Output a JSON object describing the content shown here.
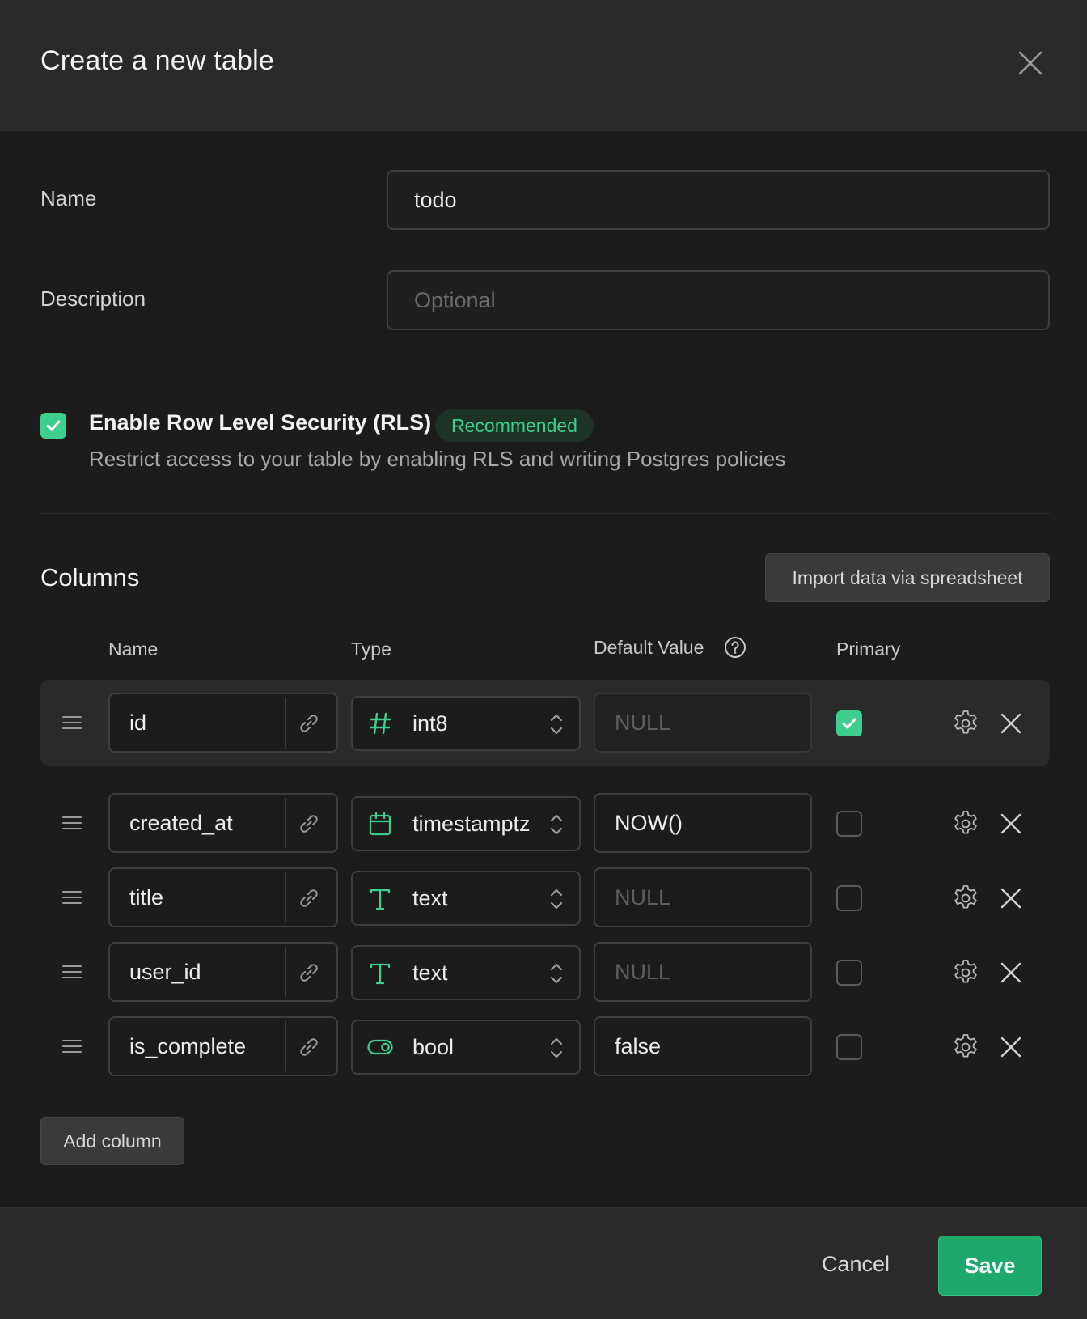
{
  "header": {
    "title": "Create a new table",
    "close_icon": "close-icon"
  },
  "form": {
    "name_label": "Name",
    "name_value": "todo",
    "description_label": "Description",
    "description_placeholder": "Optional"
  },
  "rls": {
    "checked": true,
    "title": "Enable Row Level Security (RLS)",
    "badge": "Recommended",
    "description": "Restrict access to your table by enabling RLS and writing Postgres policies"
  },
  "columns": {
    "section_title": "Columns",
    "import_button": "Import data via spreadsheet",
    "headers": {
      "name": "Name",
      "type": "Type",
      "default": "Default Value",
      "primary": "Primary"
    },
    "rows": [
      {
        "name": "id",
        "type": "int8",
        "type_icon": "hash-icon",
        "default": "NULL",
        "default_is_placeholder": true,
        "primary": true
      },
      {
        "name": "created_at",
        "type": "timestamptz",
        "type_icon": "calendar-icon",
        "default": "NOW()",
        "default_is_placeholder": false,
        "primary": false
      },
      {
        "name": "title",
        "type": "text",
        "type_icon": "text-type-icon",
        "default": "NULL",
        "default_is_placeholder": true,
        "primary": false
      },
      {
        "name": "user_id",
        "type": "text",
        "type_icon": "text-type-icon",
        "default": "NULL",
        "default_is_placeholder": true,
        "primary": false
      },
      {
        "name": "is_complete",
        "type": "bool",
        "type_icon": "toggle-icon",
        "default": "false",
        "default_is_placeholder": false,
        "primary": false
      }
    ],
    "add_button": "Add column"
  },
  "footer": {
    "cancel_label": "Cancel",
    "save_label": "Save"
  },
  "colors": {
    "accent": "#3ecf8e",
    "save": "#1fa86c",
    "background": "#1c1c1c",
    "header": "#2a2a2a"
  }
}
